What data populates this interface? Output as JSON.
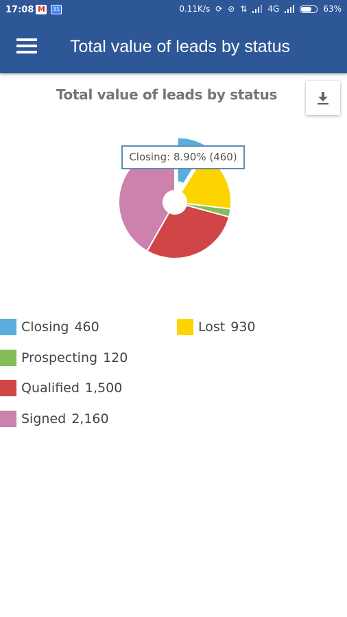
{
  "status_bar": {
    "time": "17:08",
    "network_speed": "0.11K/s",
    "network_type": "4G",
    "battery": "63%",
    "icons": [
      "gmail-icon",
      "calendar-icon",
      "sync-icon",
      "alarm-off-icon",
      "data-arrows-icon",
      "signal-icon",
      "battery-icon"
    ]
  },
  "app_bar": {
    "title": "Total value of leads by status",
    "menu_icon": "hamburger-menu-icon"
  },
  "chart": {
    "title": "Total value of leads by status",
    "download_icon": "download-icon",
    "tooltip": "Closing: 8.90% (460)"
  },
  "chart_data": {
    "type": "pie",
    "title": "Total value of leads by status",
    "categories": [
      "Closing",
      "Lost",
      "Prospecting",
      "Qualified",
      "Signed"
    ],
    "values": [
      460,
      930,
      120,
      1500,
      2160
    ],
    "labels": [
      "460",
      "930",
      "120",
      "1,500",
      "2,160"
    ],
    "colors": [
      "#5aaedb",
      "#fdd400",
      "#84bc5a",
      "#d04545",
      "#cd82ad"
    ],
    "highlighted": "Closing",
    "legend_position": "bottom"
  },
  "legend": {
    "items": [
      {
        "name": "Closing",
        "value": "460"
      },
      {
        "name": "Lost",
        "value": "930"
      },
      {
        "name": "Prospecting",
        "value": "120"
      },
      {
        "name": "Qualified",
        "value": "1,500"
      },
      {
        "name": "Signed",
        "value": "2,160"
      }
    ]
  }
}
